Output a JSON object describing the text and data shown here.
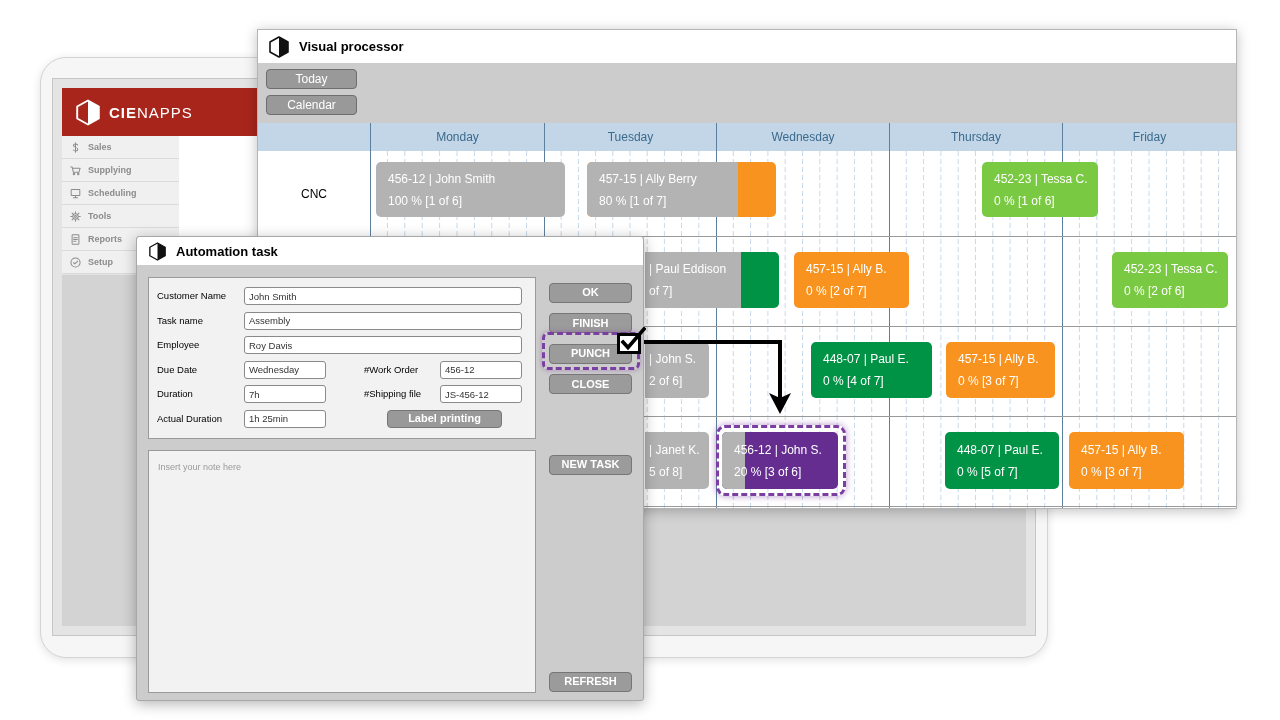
{
  "tablet": {
    "logo": "**CIE**NAPPS",
    "sidebar": {
      "items": [
        {
          "label": "Sales"
        },
        {
          "label": "Supplying"
        },
        {
          "label": "Scheduling"
        },
        {
          "label": "Tools"
        },
        {
          "label": "Reports"
        },
        {
          "label": "Setup"
        }
      ]
    }
  },
  "visual_processor": {
    "title": "Visual processor",
    "toolbar": {
      "buttons": [
        "Today",
        "Calendar"
      ]
    },
    "days": [
      "Monday",
      "Tuesday",
      "Wednesday",
      "Thursday",
      "Friday"
    ],
    "rows": [
      {
        "label": "CNC",
        "tasks": [
          {
            "title": "456-12 | John Smith",
            "progress": "100 % [1 of 6]",
            "level": 1,
            "highlighted": false
          },
          {
            "title": "457-15 | Ally Berry",
            "progress": "80 % [1 of 7]",
            "level": 0.8,
            "color": "#f7931e",
            "highlighted": false
          },
          {
            "title": "452-23 | Tessa C.",
            "progress": "0 % [1 of 6]",
            "color": "#7ac943",
            "highlighted": false
          }
        ]
      },
      {
        "tasks": [
          {
            "title": "| Paul Eddison",
            "progress": "of 7]",
            "level": 0.72,
            "color": "#009245",
            "highlighted": false
          },
          {
            "title": "457-15 | Ally B.",
            "progress": "0 % [2 of 7]",
            "color": "#f7931e",
            "highlighted": false
          },
          {
            "title": "452-23 | Tessa C.",
            "progress": "0 % [2 of 6]",
            "color": "#7ac943",
            "highlighted": false
          }
        ]
      },
      {
        "tasks": [
          {
            "title": "| John S.",
            "progress": "2 of 6]",
            "level": 1,
            "highlighted": false
          },
          {
            "title": "448-07 | Paul E.",
            "progress": "0 % [4 of 7]",
            "color": "#009245",
            "highlighted": false
          },
          {
            "title": "457-15 | Ally B.",
            "progress": "0 % [3 of 7]",
            "color": "#f7931e",
            "highlighted": false
          }
        ]
      },
      {
        "tasks": [
          {
            "title": "| Janet K.",
            "progress": "5 of 8]",
            "level": 1,
            "highlighted": false
          },
          {
            "title": "456-12 | John S.",
            "progress": "20 % [3 of 6]",
            "level": 0.2,
            "color": "#662d91",
            "highlighted": true
          },
          {
            "title": "448-07 | Paul E.",
            "progress": "0 % [5 of 7]",
            "color": "#009245",
            "highlighted": false
          },
          {
            "title": "457-15 | Ally B.",
            "progress": "0 % [3 of 7]",
            "color": "#f7931e",
            "highlighted": false
          }
        ]
      }
    ]
  },
  "automation_task": {
    "title": "Automation task",
    "form_rows": [
      {
        "fields": [
          {
            "label": "Customer Name",
            "value": "John Smith"
          }
        ]
      },
      {
        "fields": [
          {
            "label": "Task name",
            "value": "Assembly"
          }
        ]
      },
      {
        "fields": [
          {
            "label": "Employee",
            "value": "Roy Davis"
          }
        ]
      },
      {
        "fields": [
          {
            "label": "Due Date",
            "value": "Wednesday"
          },
          {
            "label": "#Work Order",
            "value": "456-12"
          }
        ]
      },
      {
        "fields": [
          {
            "label": "Duration",
            "value": "7h"
          },
          {
            "label": "#Shipping file",
            "value": "JS-456-12"
          }
        ]
      },
      {
        "fields": [
          {
            "label": "Actual Duration",
            "value": "1h 25min"
          }
        ],
        "button": "Label printing"
      }
    ],
    "note": {
      "placeholder": "Insert your note here"
    },
    "buttons": [
      {
        "label": "OK",
        "highlighted": false,
        "checked": false
      },
      {
        "label": "FINISH",
        "highlighted": false,
        "checked": false
      },
      {
        "label": "PUNCH",
        "highlighted": true,
        "checked": true
      },
      {
        "label": "CLOSE",
        "highlighted": false,
        "checked": false
      },
      {
        "label": "NEW TASK",
        "highlighted": false,
        "checked": false
      },
      {
        "label": "REFRESH",
        "highlighted": false,
        "checked": false
      }
    ]
  }
}
